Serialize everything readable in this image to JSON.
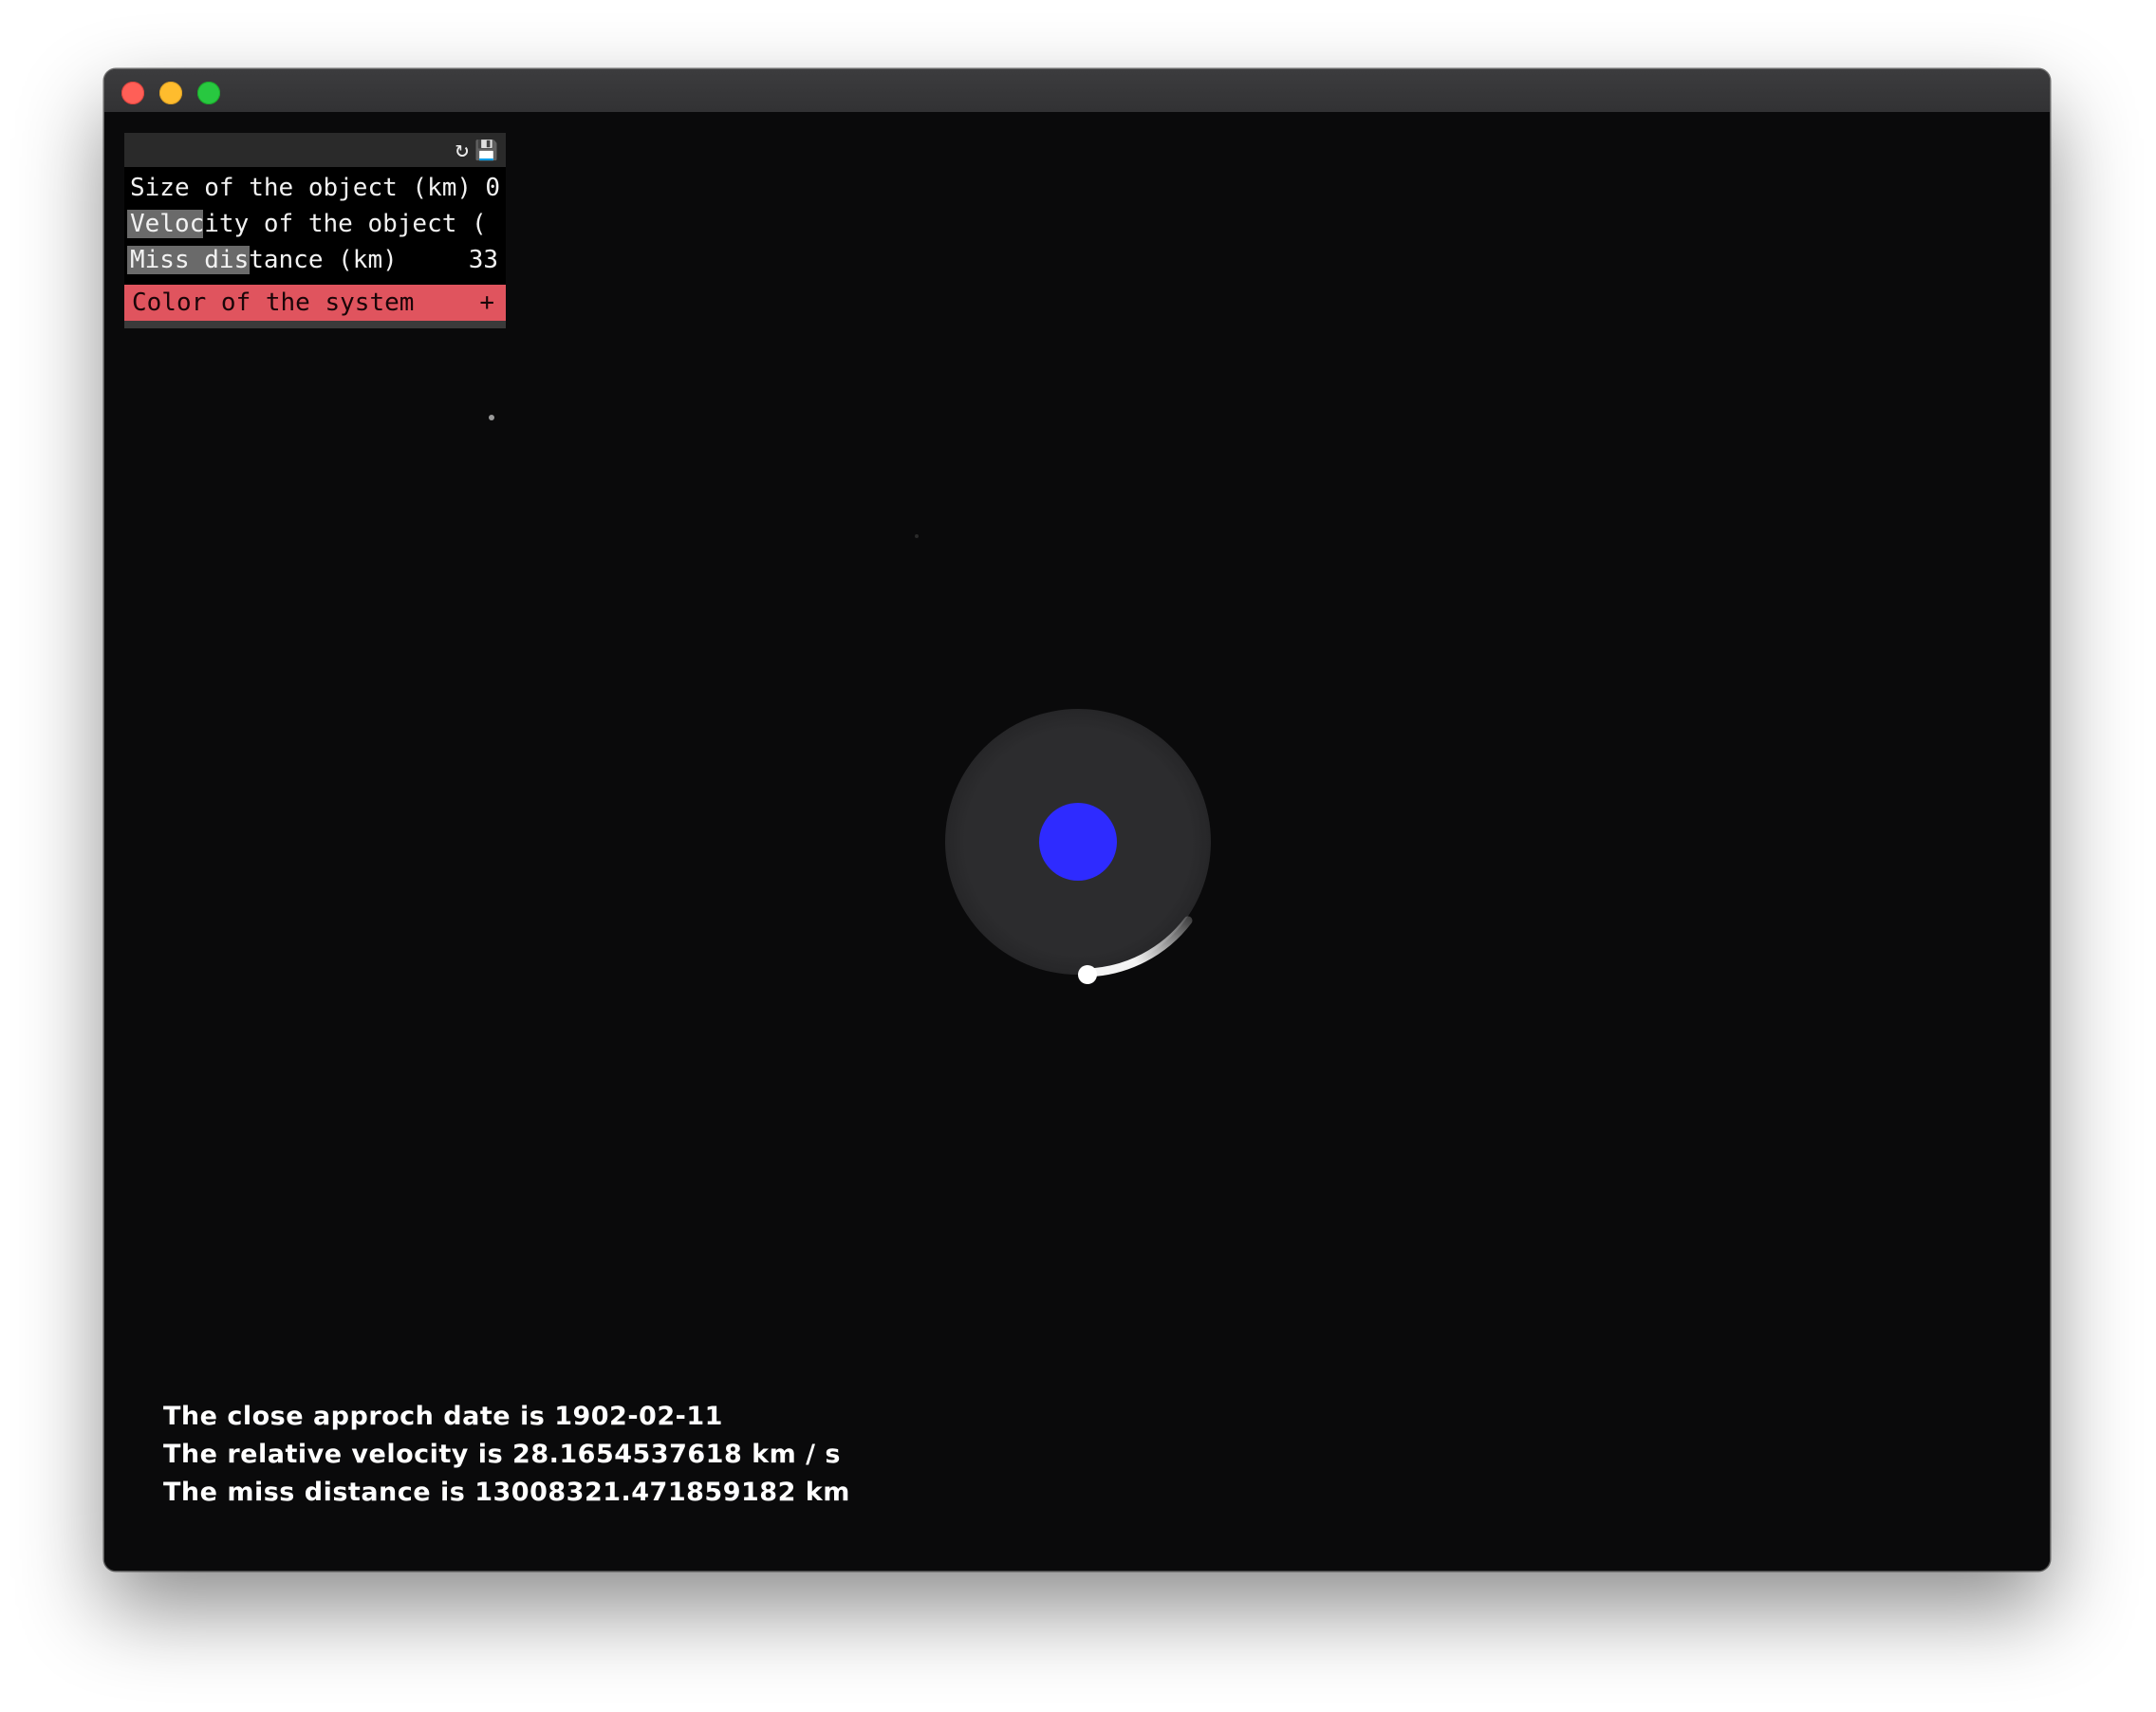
{
  "window": {
    "controls": [
      "close-button",
      "minimize-button",
      "maximize-button"
    ]
  },
  "gui": {
    "header_icons": {
      "refresh": "↻",
      "save": "💾"
    },
    "rows": [
      {
        "label": "Size of the object (km)",
        "value": "0",
        "fill": 0.0
      },
      {
        "label": "Velocity of the object (",
        "value": "",
        "fill": 0.2
      },
      {
        "label": "Miss distance (km)",
        "value": "33",
        "fill": 0.32
      }
    ],
    "color_folder": {
      "label": "Color of the system",
      "toggle": "+",
      "color": "#e0545e"
    }
  },
  "scene": {
    "planet_color": "#2e2bff",
    "orbit_color": "#2b2b2d",
    "object_color": "#ffffff"
  },
  "info": {
    "date_line": "The close approch date is 1902-02-11",
    "velocity_line": "The relative velocity is 28.1654537618 km / s",
    "distance_line": "The miss distance is 13008321.471859182 km"
  }
}
